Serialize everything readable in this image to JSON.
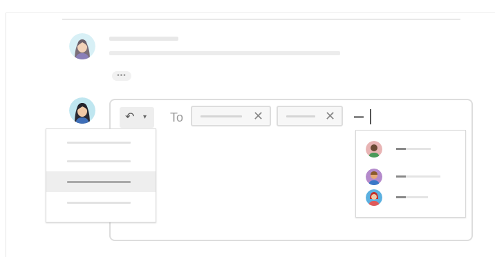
{
  "thread": {
    "previous_message": {
      "author": "female-avatar-purple",
      "collapsed_indicator": "•••"
    },
    "reply": {
      "author": "female-avatar-blue",
      "reply_button": {
        "icon": "reply-icon",
        "dropdown_icon": "caret-down-icon"
      },
      "to_label": "To",
      "recipient_chips": [
        {
          "remove_label": "✕"
        },
        {
          "remove_label": "✕"
        }
      ]
    }
  },
  "reply_type_menu": {
    "selected_index": 2,
    "item_count": 4
  },
  "autocomplete": {
    "suggestions": [
      {
        "avatar": "person-green-shirt-avatar",
        "color": "#e8b4b4"
      },
      {
        "avatar": "person-blue-shirt-avatar",
        "color": "#b48acb"
      },
      {
        "avatar": "person-red-hair-avatar",
        "color": "#5bb0e0"
      }
    ]
  },
  "colors": {
    "border": "#dddddd",
    "chip_bg": "#f7f7f7",
    "selected_bg": "#eeeeee"
  }
}
